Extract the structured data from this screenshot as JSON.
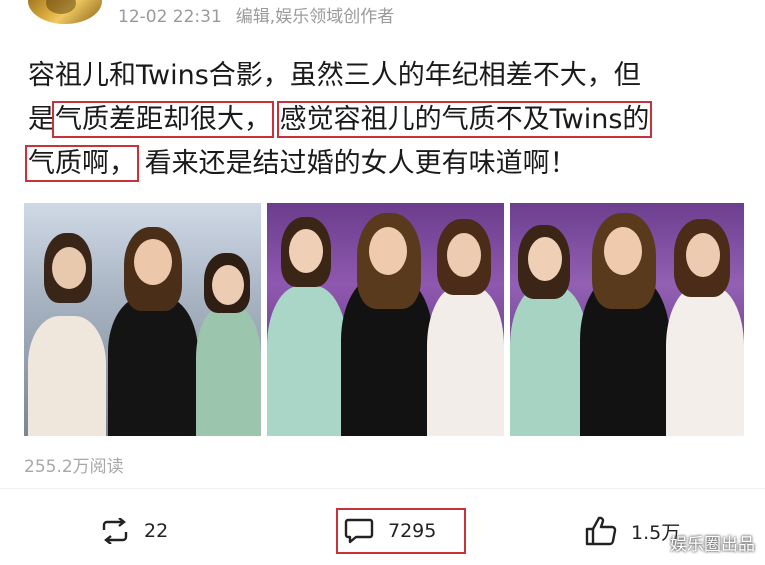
{
  "header": {
    "timestamp": "12-02 22:31",
    "source": "编辑,娱乐领域创作者"
  },
  "post": {
    "lines": [
      {
        "segments": [
          {
            "text": "容祖儿和Twins合影，虽然三人的年纪相差不大，但",
            "highlight": false
          }
        ]
      },
      {
        "segments": [
          {
            "text": "是",
            "highlight": false
          },
          {
            "text": "气质差距却很大，",
            "highlight": true
          },
          {
            "text": " ",
            "highlight": false
          },
          {
            "text": "感觉容祖儿的气质不及Twins的",
            "highlight": true
          }
        ]
      },
      {
        "segments": [
          {
            "text": "气质啊，",
            "highlight": true
          },
          {
            "text": " 看来还是结过婚的女人更有味道啊！",
            "highlight": false
          }
        ]
      }
    ]
  },
  "stats": {
    "reads": "255.2万阅读"
  },
  "actions": {
    "repost_count": "22",
    "comment_count": "7295",
    "like_count": "1.5万"
  },
  "watermark": "娱乐圈出品",
  "colors": {
    "highlight_border": "#c8323a",
    "meta_text": "#9a9a9a"
  }
}
